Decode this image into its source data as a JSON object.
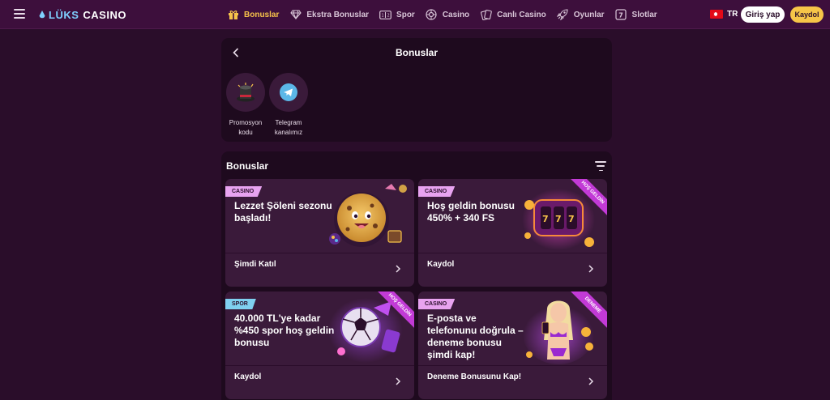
{
  "header": {
    "logo_part1": "LÜKS",
    "logo_part2": "CASINO",
    "nav": [
      {
        "label": "Bonuslar",
        "icon": "gift-icon",
        "active": true
      },
      {
        "label": "Ekstra Bonuslar",
        "icon": "diamond-icon",
        "active": false
      },
      {
        "label": "Spor",
        "icon": "scoreboard-icon",
        "active": false
      },
      {
        "label": "Casino",
        "icon": "roulette-icon",
        "active": false
      },
      {
        "label": "Canlı Casino",
        "icon": "cards-icon",
        "active": false
      },
      {
        "label": "Oyunlar",
        "icon": "rocket-icon",
        "active": false
      },
      {
        "label": "Slotlar",
        "icon": "slot-icon",
        "active": false
      }
    ],
    "lang_code": "TR",
    "login_label": "Giriş yap",
    "register_label": "Kaydol"
  },
  "top_panel": {
    "title": "Bonuslar",
    "quick_links": [
      {
        "label_line1": "Promosyon",
        "label_line2": "kodu",
        "icon": "magic-hat-icon"
      },
      {
        "label_line1": "Telegram",
        "label_line2": "kanalımız",
        "icon": "telegram-icon"
      }
    ]
  },
  "bonuses": {
    "title": "Bonuslar",
    "cards": [
      {
        "badge": "CASINO",
        "badge_type": "casino",
        "title": "Lezzet Şöleni sezonu başladı!",
        "cta": "Şimdi Katıl",
        "art": "cookie-icon",
        "ribbon": ""
      },
      {
        "badge": "CASINO",
        "badge_type": "casino",
        "title": "Hoş geldin bonusu 450% + 340 FS",
        "cta": "Kaydol",
        "art": "slot-machine-icon",
        "ribbon": "HOŞ GELDİN"
      },
      {
        "badge": "SPOR",
        "badge_type": "spor",
        "title": "40.000 TL'ye kadar %450 spor hoş geldin bonusu",
        "cta": "Kaydol",
        "art": "football-icon",
        "ribbon": "HOŞ GELDİN"
      },
      {
        "badge": "CASINO",
        "badge_type": "casino",
        "title": "E-posta ve telefonunu doğrula – deneme bonusu şimdi kap!",
        "cta": "Deneme Bonusunu Kap!",
        "art": "hostess-icon",
        "ribbon": "DENEME"
      }
    ]
  },
  "colors": {
    "header_bg": "#3d0f3c",
    "page_bg": "#2a0d2a",
    "panel_bg": "#1e0a1e",
    "card_bg": "#3a1a3a",
    "accent_gold": "#f7c34a",
    "badge_casino": "#e8a3f0",
    "badge_spor": "#7fd0f0",
    "ribbon": "#c23ad6"
  }
}
